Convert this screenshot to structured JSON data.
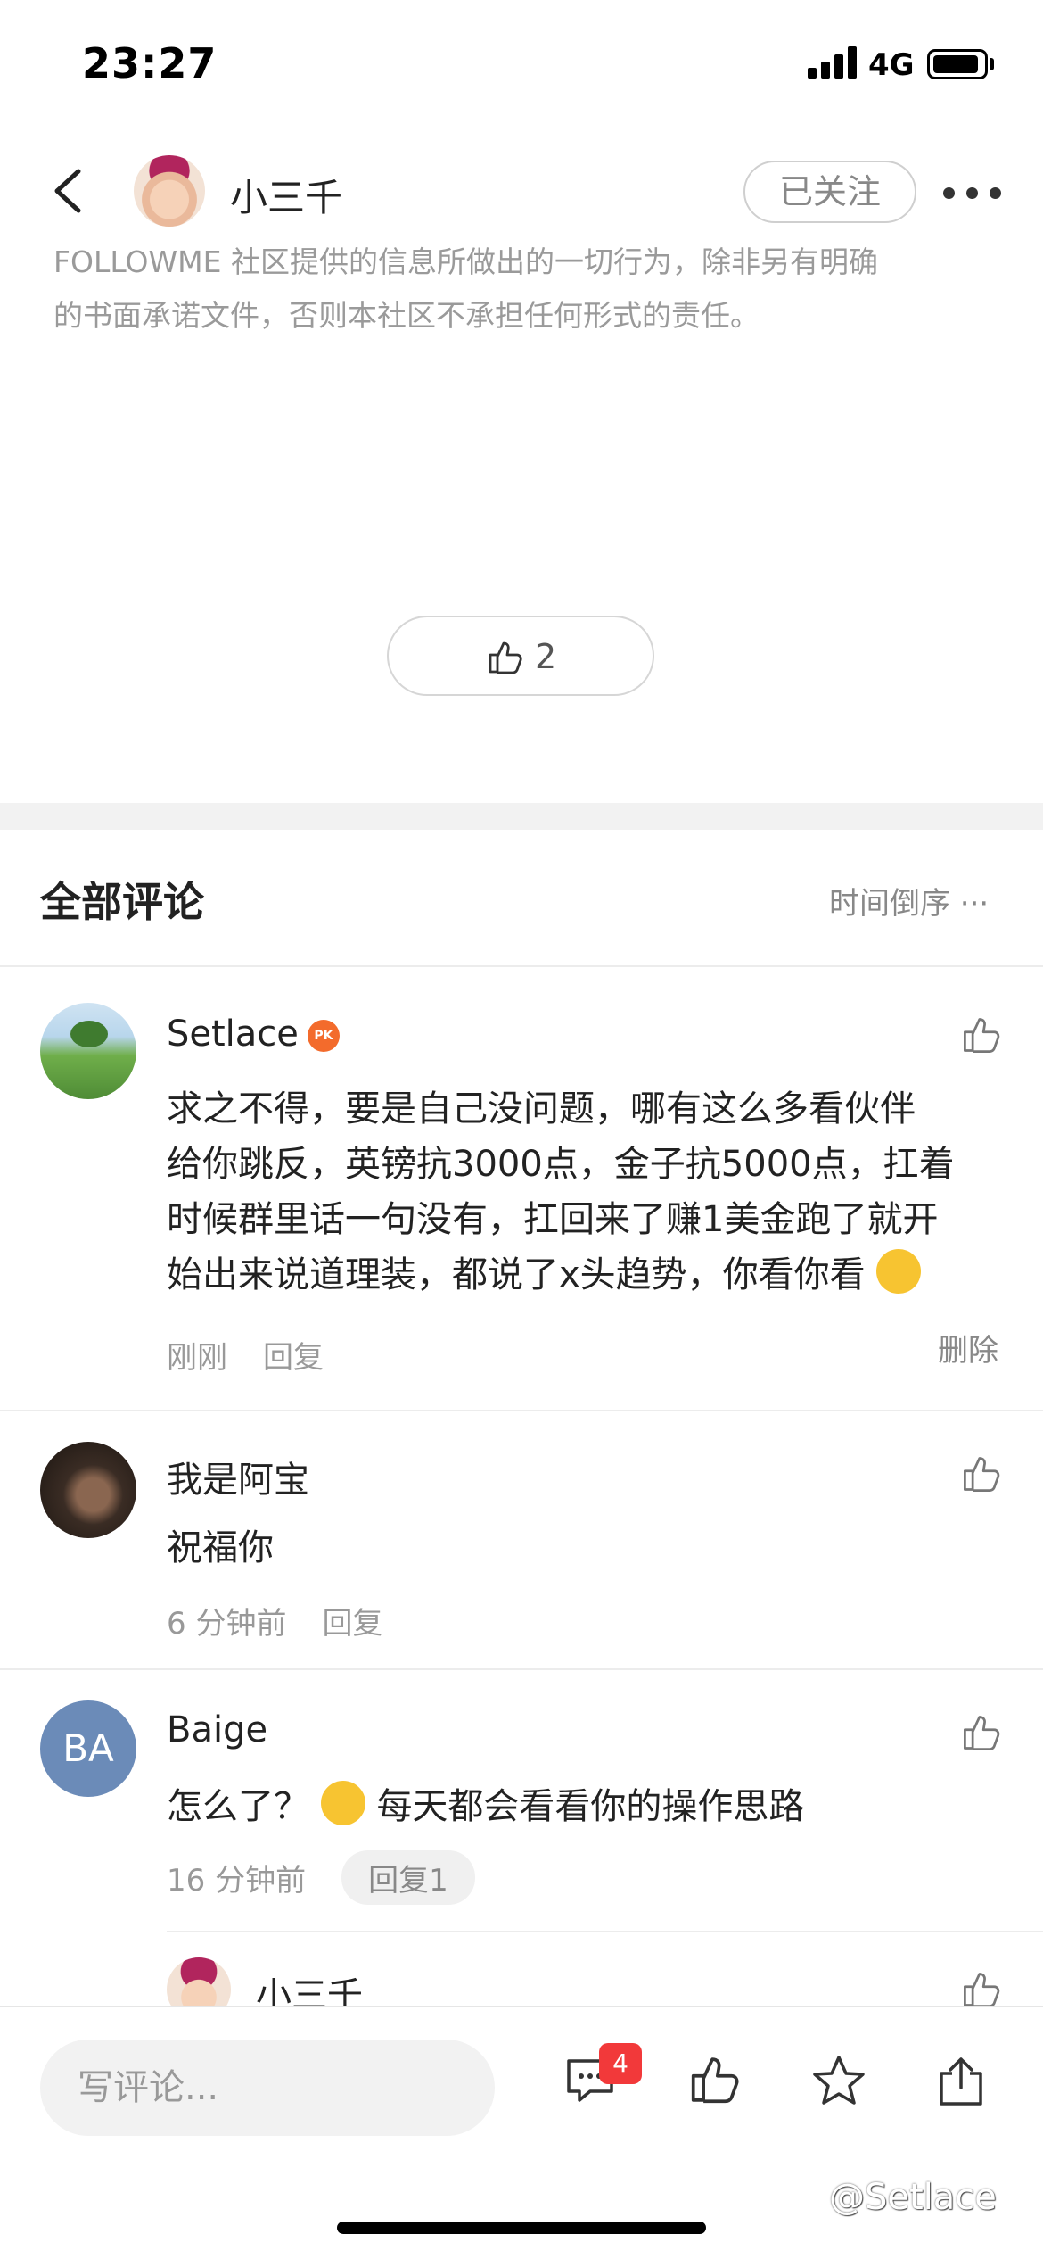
{
  "status_bar": {
    "time": "23:27",
    "network": "4G"
  },
  "nav": {
    "title": "小三千",
    "follow_label": "已关注"
  },
  "post": {
    "disclaimer_line1": "FOLLOWME 社区提供的信息所做出的一切行为，除非另有明确",
    "disclaimer_line2": "的书面承诺文件，否则本社区不承担任何形式的责任。",
    "like_count": "2"
  },
  "comments_section": {
    "title": "全部评论",
    "sort_label": "时间倒序 ···"
  },
  "comments": [
    {
      "name": "Setlace",
      "badge": "PK",
      "body_lines": [
        "求之不得，要是自己没问题，哪有这么多看伙伴",
        "给你跳反，英镑抗3000点，金子抗5000点，扛着",
        "时候群里话一句没有，扛回来了赚1美金跑了就开",
        "始出来说道理装，都说了x头趋势，你看你看"
      ],
      "time": "刚刚",
      "reply_label": "回复",
      "delete_label": "删除"
    },
    {
      "name": "我是阿宝",
      "body": "祝福你",
      "time": "6 分钟前",
      "reply_label": "回复"
    },
    {
      "name": "Baige",
      "avatar_initials": "BA",
      "body_before_emoji": "怎么了？",
      "body_after_emoji": "每天都会看看你的操作思路",
      "time": "16 分钟前",
      "reply_label": "回复1"
    },
    {
      "name": "小三千"
    }
  ],
  "bottom_bar": {
    "input_placeholder": "写评论...",
    "comment_count": "4"
  },
  "watermark": "@Setlace",
  "colors": {
    "accent_red": "#f2393a",
    "text_primary": "#222222",
    "text_secondary": "#999999",
    "avatar_ba": "#6b8bb8"
  }
}
